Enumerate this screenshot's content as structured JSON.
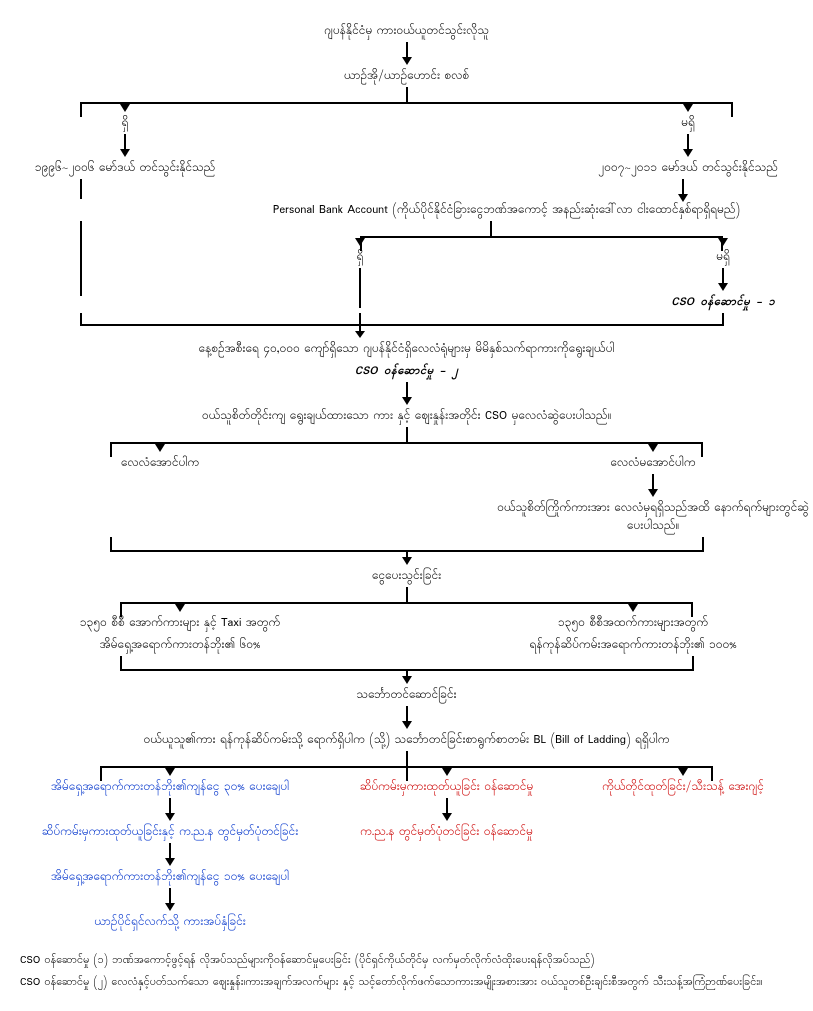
{
  "title": "ဂျပန်နိုင်ငံမှ ကားဝယ်ယူတင်သွင်းလိုသူ",
  "step_owner": "ယာဉ်အို/ယာဉ်ဟောင်း စလစ်",
  "branch_yes": "ရှိ",
  "branch_no": "မရှိ",
  "left_model": "၁၉၉၆~၂၀၀၆ မော်ဒယ် တင်သွင်းနိုင်သည်",
  "right_model": "၂၀၀၇~၂၀၁၁ မော်ဒယ် တင်သွင်းနိုင်သည်",
  "bank_account": "Personal Bank Account (ကိုယ်ပိုင်နိုင်ငံခြားငွေဘဏ်အကောင့် အနည်းဆုံးဒေါ်လာ ငါးထောင်နှစ်ရာရှိရမည်)",
  "bank_yes": "ရှိ",
  "bank_no": "မရှိ",
  "cso1": "CSO ဝန်ဆောင်မှု - ၁",
  "auction_text": "နေ့စဉ်အစီးရေ ၄၀,၀၀၀ ကျော်ရှိသော ဂျပန်နိုင်ငံရှိလေလံရုံများမှ မိမိနှစ်သက်ရာကားကိုရွေးချယ်ပါ",
  "cso2": "CSO ဝန်ဆောင်မှု - ၂",
  "buyer_choice": "ဝယ်သူစိတ်တိုင်းကျ ရွေးချယ်ထားသော ကား နှင့် ဈေးနှုန်းအတိုင်း CSO မှလေလံဆွဲပေးပါသည်။",
  "auction_success": "လေလံအောင်ပါက",
  "auction_fail": "လေလံမအောင်ပါက",
  "retry": "ဝယ်သူစိတ်ကြိုက်ကားအား လေလံမှရရှိသည်အထိ နောက်ရက်များတွင်ဆွဲပေးပါသည်။",
  "payment": "ငွေပေးသွင်းခြင်း",
  "left_cc": "၁၃၅၀ စီစီ အောက်ကားများ နှင့် Taxi အတွက်",
  "left_cc_bold": "အိမ်ရှေ့အရောက်ကားတန်ဘိုး၏ ၆၀%",
  "right_cc": "၁၃၅၀ စီစီအထက်ကားများအတွက်",
  "right_cc_bold": "ရန်ကုန်ဆိပ်ကမ်းအရောက်ကားတန်ဘိုး၏ ၁၀၀%",
  "shipping": "သင်္ဘောတင်ဆောင်ခြင်း",
  "arrival": "ဝယ်ယူသူ၏ကား ရန်ကုန်ဆိပ်ကမ်းသို့ ရောက်ရှိပါက (သို့) သင်္ဘောတင်ခြင်းစာရွက်စာတမ်း BL (Bill of Ladding) ရရှိပါက",
  "blue1": "အိမ်ရှေ့အရောက်ကားတန်ဘိုး၏ကျန်ငွေ ၃၀% ပေးချေပါ",
  "blue2": "ဆိပ်ကမ်းမှကားထုတ်ယူခြင်းနှင့် က.ည.န တွင်မှတ်ပုံတင်ခြင်း",
  "blue3": "အိမ်ရှေ့အရောက်ကားတန်ဘိုး၏ကျန်ငွေ ၁၀% ပေးချေပါ",
  "blue4": "ယာဉ်ပိုင်ရှင်လက်သို့ ကားအပ်နှံခြင်း",
  "red1": "ဆိပ်ကမ်းမှကားထုတ်ယူခြင်း ဝန်ဆောင်မှု",
  "red2": "က.ည.န တွင်မှတ်ပုံတင်ခြင်း ဝန်ဆောင်မှု",
  "red3": "ကိုယ်တိုင်ထုတ်ခြင်း/သီးသန့် အေးဂျင့်",
  "footnote1": "CSO ဝန်ဆောင်မှု (၁) ဘဏ်အကောင့်ဖွင့်ရန် လိုအပ်သည်များကိုဝန်ဆောင်မှုပေးခြင်း (ပိုင်ရှင်ကိုယ်တိုင်မှ လက်မှတ်လိုက်လံထိုးပေးရန်လိုအပ်သည်)",
  "footnote2": "CSO ဝန်ဆောင်မှု (၂) လေလံနှင့်ပတ်သက်သော ဈေးနှုန်း၊ကားအချက်အလက်များ နှင့် သင့်တော်လိုက်ဖက်သောကားအမျိုးအစားအား ဝယ်သူတစ်ဦးချင်းစီအတွက် သီးသန့်အကြံဉာဏ်ပေးခြင်း။"
}
